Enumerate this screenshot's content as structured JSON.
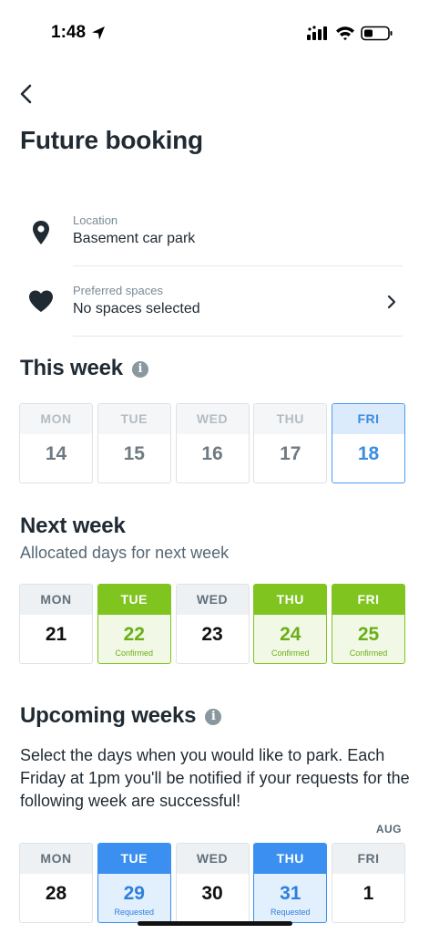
{
  "status": {
    "time": "1:48"
  },
  "header": {
    "title": "Future booking"
  },
  "location": {
    "label": "Location",
    "value": "Basement car park"
  },
  "preferred": {
    "label": "Preferred spaces",
    "value": "No spaces selected"
  },
  "this_week": {
    "title": "This week",
    "days": [
      {
        "name": "MON",
        "date": "14",
        "state": "past",
        "status": ""
      },
      {
        "name": "TUE",
        "date": "15",
        "state": "past",
        "status": ""
      },
      {
        "name": "WED",
        "date": "16",
        "state": "past",
        "status": ""
      },
      {
        "name": "THU",
        "date": "17",
        "state": "past",
        "status": ""
      },
      {
        "name": "FRI",
        "date": "18",
        "state": "today",
        "status": ""
      }
    ]
  },
  "next_week": {
    "title": "Next week",
    "subtitle": "Allocated days for next week",
    "days": [
      {
        "name": "MON",
        "date": "21",
        "state": "plain",
        "status": ""
      },
      {
        "name": "TUE",
        "date": "22",
        "state": "confirmed",
        "status": "Confirmed"
      },
      {
        "name": "WED",
        "date": "23",
        "state": "plain",
        "status": ""
      },
      {
        "name": "THU",
        "date": "24",
        "state": "confirmed",
        "status": "Confirmed"
      },
      {
        "name": "FRI",
        "date": "25",
        "state": "confirmed",
        "status": "Confirmed"
      }
    ]
  },
  "upcoming": {
    "title": "Upcoming weeks",
    "description": "Select the days when you would like to park. Each Friday at 1pm you'll be notified if your requests for the following week are successful!",
    "month": "AUG",
    "days": [
      {
        "name": "MON",
        "date": "28",
        "state": "plain",
        "status": ""
      },
      {
        "name": "TUE",
        "date": "29",
        "state": "requested",
        "status": "Requested"
      },
      {
        "name": "WED",
        "date": "30",
        "state": "plain",
        "status": ""
      },
      {
        "name": "THU",
        "date": "31",
        "state": "requested",
        "status": "Requested"
      },
      {
        "name": "FRI",
        "date": "1",
        "state": "plain",
        "status": ""
      }
    ]
  },
  "colors": {
    "confirmed": "#7fc41f",
    "requested": "#3a8ff0",
    "today": "#4a9cf0",
    "text": "#1f2a33"
  }
}
